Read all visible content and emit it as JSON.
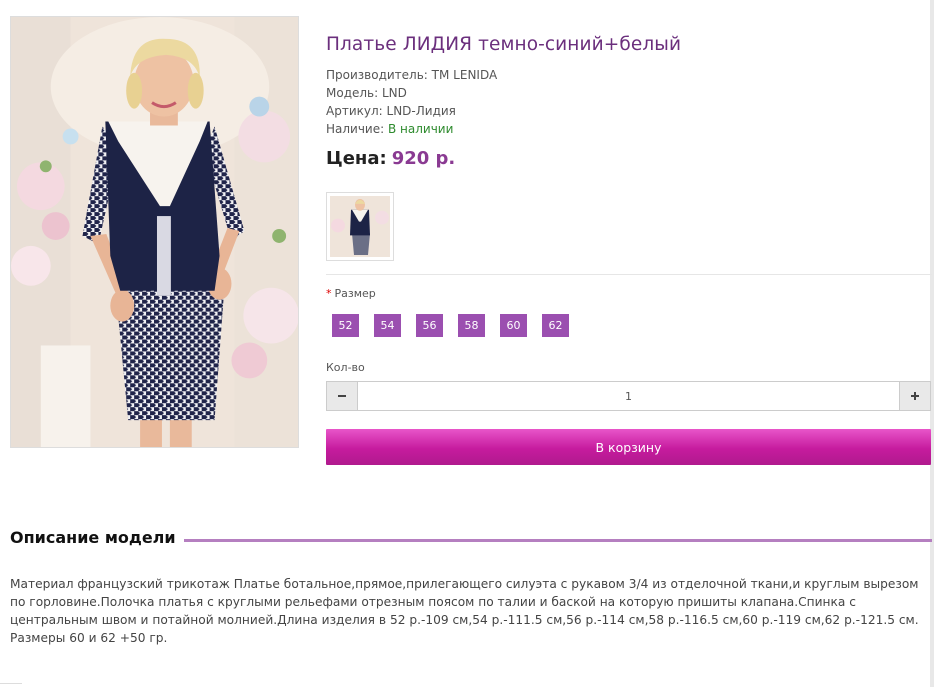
{
  "product": {
    "title": "Платье ЛИДИЯ темно-синий+белый",
    "manufacturer_label": "Производитель:",
    "manufacturer": "ТМ LENIDA",
    "model_label": "Модель:",
    "model": "LND",
    "sku_label": "Артикул:",
    "sku": "LND-Лидия",
    "availability_label": "Наличие:",
    "availability": "В наличии",
    "price_label": "Цена:",
    "price": "920 р."
  },
  "options": {
    "size_label": "Размер",
    "required_mark": "*",
    "sizes": [
      "52",
      "54",
      "56",
      "58",
      "60",
      "62"
    ],
    "qty_label": "Кол-во",
    "qty_value": "1",
    "minus_icon": "minus-icon",
    "plus_icon": "plus-icon"
  },
  "cart": {
    "button_label": "В корзину"
  },
  "description": {
    "heading": "Описание модели",
    "text": "Материал французский трикотаж Платье ботальное,прямое,прилегающего силуэта с рукавом 3/4 из отделочной ткани,и круглым вырезом по горловине.Полочка платья с круглыми рельефами отрезным поясом по талии и баской на которую пришиты клапана.Спинка с центральным швом и потайной молнией.Длина изделия в 52 р.-109 см,54 р.-111.5 см,56 р.-114 см,58 р.-116.5 см,60 р.-119 см,62 р.-121.5 см. Размеры 60 и 62 +50 гр."
  },
  "colors": {
    "title": "#6b2f7d",
    "price": "#8a3a92",
    "size_button": "#9b4fb0",
    "cart_button": "#c61b9e",
    "in_stock": "#2e8b2e",
    "divider_accent": "#b57fc0"
  }
}
